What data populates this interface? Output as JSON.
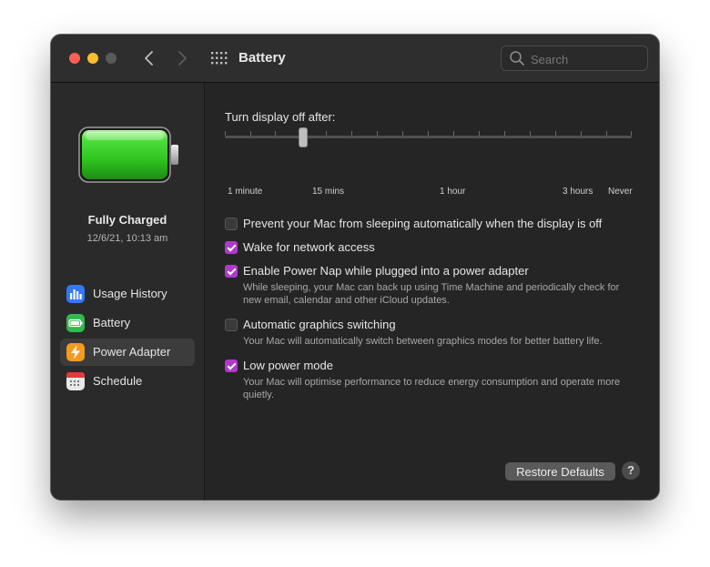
{
  "window": {
    "title": "Battery",
    "search": {
      "placeholder": "Search",
      "value": ""
    }
  },
  "sidebar": {
    "status": {
      "title": "Fully Charged",
      "time": "12/6/21, 10:13 am"
    },
    "items": [
      {
        "label": "Usage History",
        "icon": "bar-chart-icon",
        "color": "#3478f6"
      },
      {
        "label": "Battery",
        "icon": "battery-icon",
        "color": "#30b94d"
      },
      {
        "label": "Power Adapter",
        "icon": "lightning-bolt-icon",
        "color": "#f39b1d",
        "active": true
      },
      {
        "label": "Schedule",
        "icon": "calendar-icon",
        "color": "#e8e8e8"
      }
    ]
  },
  "display_off": {
    "label": "Turn display off after:",
    "tick_labels": [
      "1 minute",
      "15 mins",
      "1 hour",
      "3 hours",
      "Never"
    ],
    "selected": "15 mins"
  },
  "options": [
    {
      "label": "Prevent your Mac from sleeping automatically when the display is off",
      "checked": false,
      "description": ""
    },
    {
      "label": "Wake for network access",
      "checked": true,
      "description": ""
    },
    {
      "label": "Enable Power Nap while plugged into a power adapter",
      "checked": true,
      "description": "While sleeping, your Mac can back up using Time Machine and periodically check for new email, calendar and other iCloud updates."
    },
    {
      "label": "Automatic graphics switching",
      "checked": false,
      "description": "Your Mac will automatically switch between graphics modes for better battery life."
    },
    {
      "label": "Low power mode",
      "checked": true,
      "description": "Your Mac will optimise performance to reduce energy consumption and operate more quietly."
    }
  ],
  "footer": {
    "restore_label": "Restore Defaults",
    "help_label": "?"
  },
  "colors": {
    "accent": "#b03ac8",
    "battery_green": "#3fd13a"
  }
}
